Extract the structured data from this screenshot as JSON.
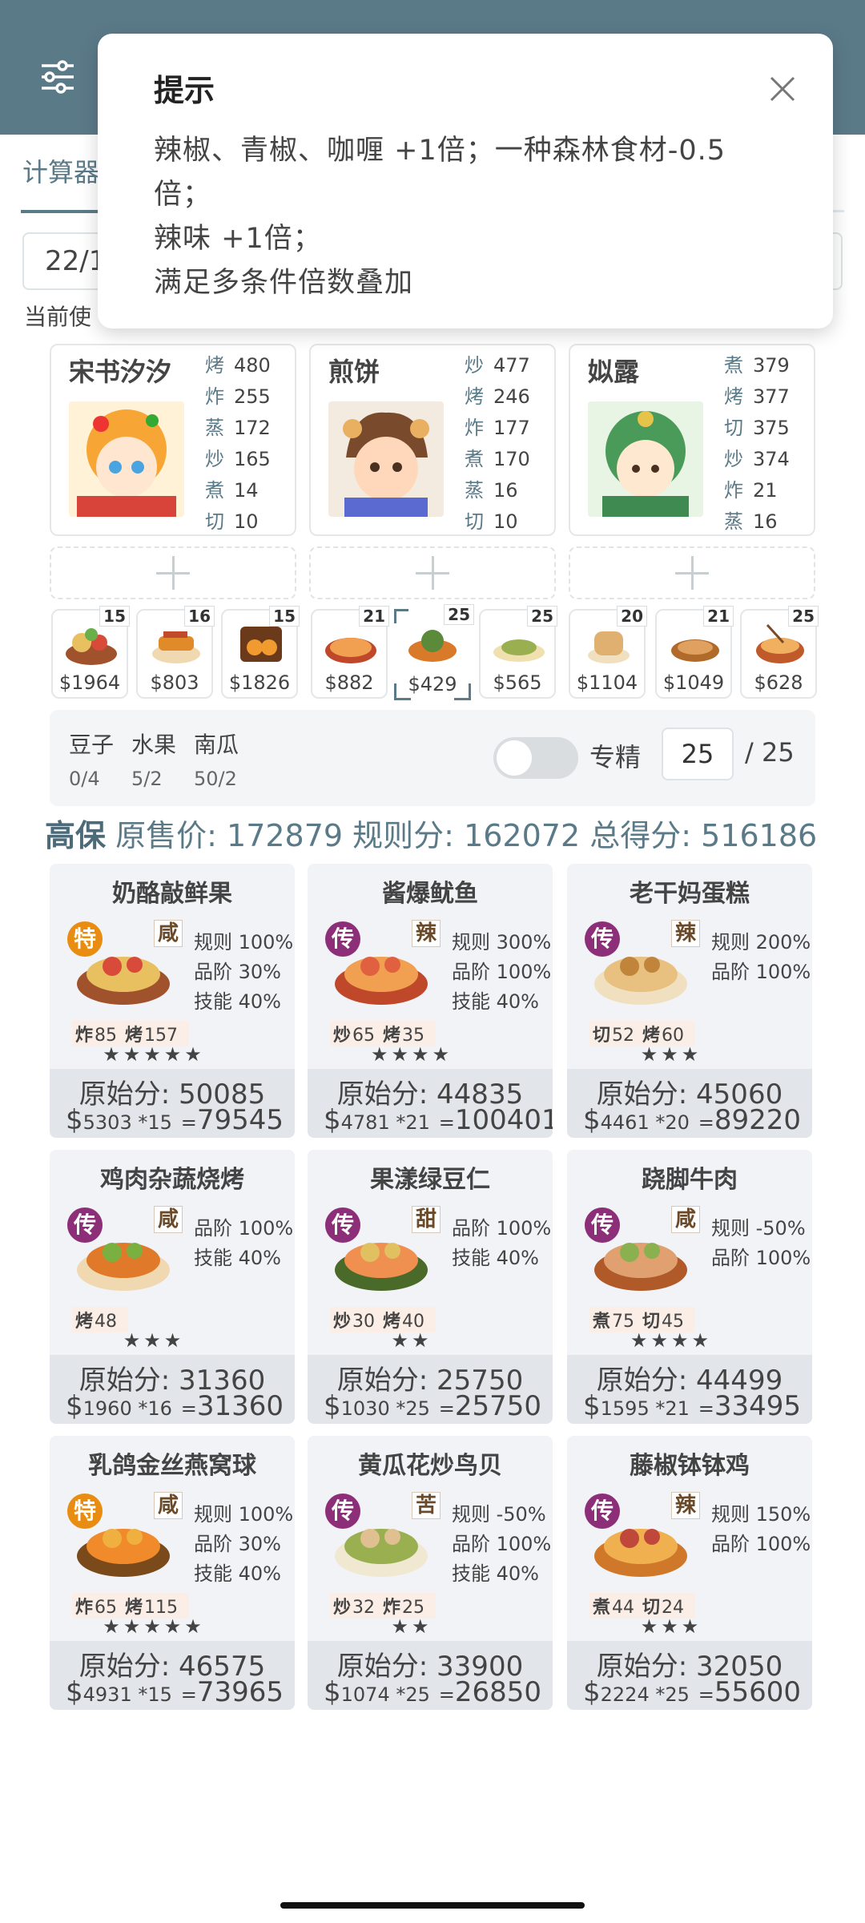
{
  "header": {
    "menu_icon": "sliders-icon"
  },
  "tabs": {
    "active": "计算器"
  },
  "date_input": {
    "value": "22/1"
  },
  "current_use": "当前使",
  "dialog": {
    "title": "提示",
    "lines": [
      "辣椒、青椒、咖喱 +1倍；一种森林食材-0.5",
      "倍；",
      "辣味 +1倍；",
      "满足多条件倍数叠加"
    ]
  },
  "chefs": [
    {
      "name": "宋书汐汐",
      "skills": [
        [
          "烤",
          "480"
        ],
        [
          "炸",
          "255"
        ],
        [
          "蒸",
          "172"
        ],
        [
          "炒",
          "165"
        ],
        [
          "煮",
          "14"
        ],
        [
          "切",
          "10"
        ]
      ]
    },
    {
      "name": "煎饼",
      "skills": [
        [
          "炒",
          "477"
        ],
        [
          "烤",
          "246"
        ],
        [
          "炸",
          "177"
        ],
        [
          "煮",
          "170"
        ],
        [
          "蒸",
          "16"
        ],
        [
          "切",
          "10"
        ]
      ]
    },
    {
      "name": "姒露",
      "skills": [
        [
          "煮",
          "379"
        ],
        [
          "烤",
          "377"
        ],
        [
          "切",
          "375"
        ],
        [
          "炒",
          "374"
        ],
        [
          "炸",
          "21"
        ],
        [
          "蒸",
          "16"
        ]
      ]
    }
  ],
  "slots": [
    {
      "count": "15",
      "price": "$1964"
    },
    {
      "count": "16",
      "price": "$803"
    },
    {
      "count": "15",
      "price": "$1826"
    },
    {
      "count": "21",
      "price": "$882"
    },
    {
      "count": "25",
      "price": "$429"
    },
    {
      "count": "25",
      "price": "$565"
    },
    {
      "count": "20",
      "price": "$1104"
    },
    {
      "count": "21",
      "price": "$1049"
    },
    {
      "count": "25",
      "price": "$628"
    }
  ],
  "ingredients": [
    {
      "name": "豆子",
      "value": "0/4"
    },
    {
      "name": "水果",
      "value": "5/2"
    },
    {
      "name": "南瓜",
      "value": "50/2"
    }
  ],
  "specialist": {
    "label": "专精",
    "value": "25",
    "total": "/ 25",
    "toggle_on": false
  },
  "summary": {
    "tag": "高保",
    "orig_label": "原售价:",
    "orig_value": "172879",
    "rule_label": "规则分:",
    "rule_value": "162072",
    "total_label": "总得分:",
    "total_value": "516186"
  },
  "recipes": [
    {
      "title": "奶酪敲鲜果",
      "rarity": "特",
      "flavor": "咸",
      "rules": [
        "规则 100%",
        "品阶 30%",
        "技能 40%"
      ],
      "req": [
        [
          "炸",
          "85"
        ],
        [
          "烤",
          "157"
        ]
      ],
      "stars": "★★★★★",
      "orig": "原始分: 50085",
      "price": "$",
      "unit": "5303 *15",
      "eq": "=",
      "result": "79545"
    },
    {
      "title": "酱爆鱿鱼",
      "rarity": "传",
      "flavor": "辣",
      "rules": [
        "规则 300%",
        "品阶 100%",
        "技能 40%"
      ],
      "req": [
        [
          "炒",
          "65"
        ],
        [
          "烤",
          "35"
        ]
      ],
      "stars": "★★★★",
      "orig": "原始分: 44835",
      "price": "$",
      "unit": "4781 *21",
      "eq": "=",
      "result": "100401"
    },
    {
      "title": "老干妈蛋糕",
      "rarity": "传",
      "flavor": "辣",
      "rules": [
        "规则 200%",
        "品阶 100%"
      ],
      "req": [
        [
          "切",
          "52"
        ],
        [
          "烤",
          "60"
        ]
      ],
      "stars": "★★★",
      "orig": "原始分: 45060",
      "price": "$",
      "unit": "4461 *20",
      "eq": "=",
      "result": "89220"
    },
    {
      "title": "鸡肉杂蔬烧烤",
      "rarity": "传",
      "flavor": "咸",
      "rules": [
        "品阶 100%",
        "技能 40%"
      ],
      "req": [
        [
          "烤",
          "48"
        ]
      ],
      "stars": "★★★",
      "orig": "原始分: 31360",
      "price": "$",
      "unit": "1960 *16",
      "eq": "=",
      "result": "31360"
    },
    {
      "title": "果漾绿豆仁",
      "rarity": "传",
      "flavor": "甜",
      "rules": [
        "品阶 100%",
        "技能 40%"
      ],
      "req": [
        [
          "炒",
          "30"
        ],
        [
          "烤",
          "40"
        ]
      ],
      "stars": "★★",
      "orig": "原始分: 25750",
      "price": "$",
      "unit": "1030 *25",
      "eq": "=",
      "result": "25750"
    },
    {
      "title": "跷脚牛肉",
      "rarity": "传",
      "flavor": "咸",
      "rules": [
        "规则 -50%",
        "品阶 100%"
      ],
      "req": [
        [
          "煮",
          "75"
        ],
        [
          "切",
          "45"
        ]
      ],
      "stars": "★★★★",
      "orig": "原始分: 44499",
      "price": "$",
      "unit": "1595 *21",
      "eq": "=",
      "result": "33495"
    },
    {
      "title": "乳鸽金丝燕窝球",
      "rarity": "特",
      "flavor": "咸",
      "rules": [
        "规则 100%",
        "品阶 30%",
        "技能 40%"
      ],
      "req": [
        [
          "炸",
          "65"
        ],
        [
          "烤",
          "115"
        ]
      ],
      "stars": "★★★★★",
      "orig": "原始分: 46575",
      "price": "$",
      "unit": "4931 *15",
      "eq": "=",
      "result": "73965"
    },
    {
      "title": "黄瓜花炒鸟贝",
      "rarity": "传",
      "flavor": "苦",
      "rules": [
        "规则 -50%",
        "品阶 100%",
        "技能 40%"
      ],
      "req": [
        [
          "炒",
          "32"
        ],
        [
          "炸",
          "25"
        ]
      ],
      "stars": "★★",
      "orig": "原始分: 33900",
      "price": "$",
      "unit": "1074 *25",
      "eq": "=",
      "result": "26850"
    },
    {
      "title": "藤椒钵钵鸡",
      "rarity": "传",
      "flavor": "辣",
      "rules": [
        "规则 150%",
        "品阶 100%"
      ],
      "req": [
        [
          "煮",
          "44"
        ],
        [
          "切",
          "24"
        ]
      ],
      "stars": "★★★",
      "orig": "原始分: 32050",
      "price": "$",
      "unit": "2224 *25",
      "eq": "=",
      "result": "55600"
    }
  ]
}
